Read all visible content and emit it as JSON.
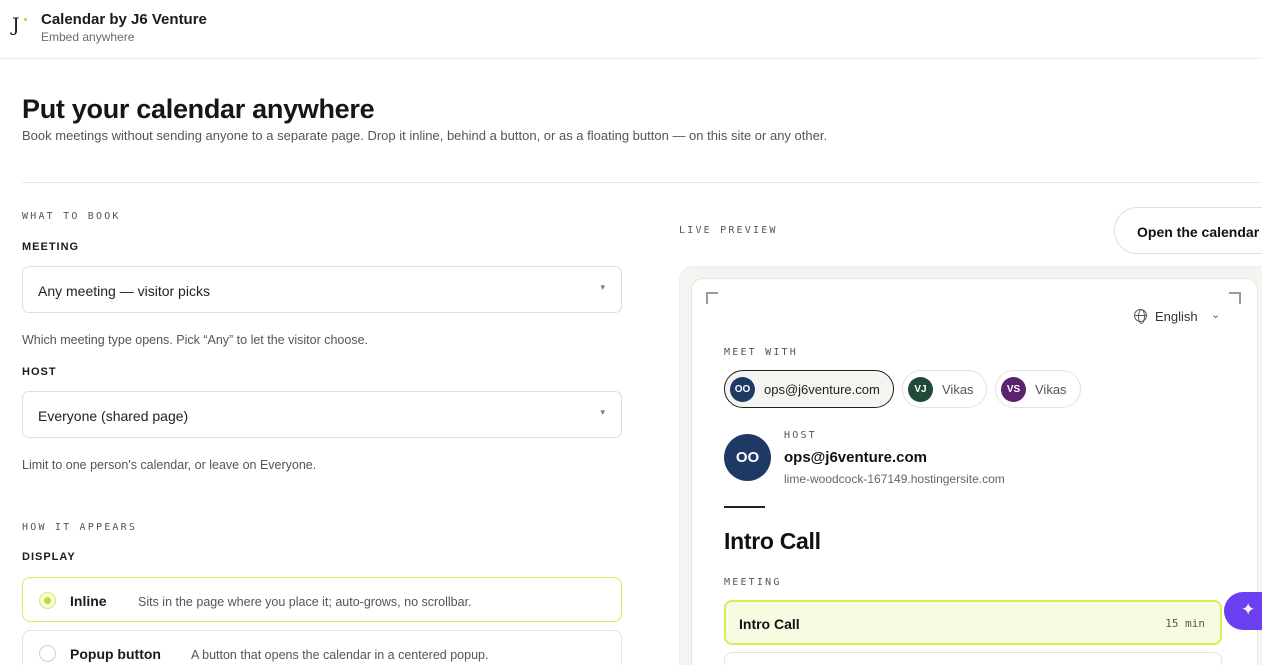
{
  "app": {
    "logo_letter": "J",
    "title": "Calendar by J6 Venture",
    "subtitle": "Embed anywhere"
  },
  "page": {
    "title": "Put your calendar anywhere",
    "description": "Book meetings without sending anyone to a separate page. Drop it inline, behind a button, or as a floating button — on this site or any other."
  },
  "config": {
    "section_what": "WHAT TO BOOK",
    "meeting_label": "MEETING",
    "meeting_value": "Any meeting — visitor picks",
    "meeting_hint": "Which meeting type opens. Pick “Any” to let the visitor choose.",
    "host_label": "HOST",
    "host_value": "Everyone (shared page)",
    "host_hint": "Limit to one person's calendar, or leave on Everyone.",
    "section_how": "HOW IT APPEARS",
    "display_label": "DISPLAY",
    "display_options": [
      {
        "title": "Inline",
        "description": "Sits in the page where you place it; auto-grows, no scrollbar.",
        "selected": true
      },
      {
        "title": "Popup button",
        "description": "A button that opens the calendar in a centered popup.",
        "selected": false
      }
    ]
  },
  "preview": {
    "label": "LIVE PREVIEW",
    "open_button": "Open the calendar",
    "language": "English",
    "meet_with_label": "MEET WITH",
    "hosts": [
      {
        "initials": "OO",
        "name": "ops@j6venture.com",
        "color": "#1e3a64",
        "active": true
      },
      {
        "initials": "VJ",
        "name": "Vikas",
        "color": "#1f4a36",
        "active": false
      },
      {
        "initials": "VS",
        "name": "Vikas",
        "color": "#5b2270",
        "active": false
      }
    ],
    "host_label": "HOST",
    "host_initials": "OO",
    "host_email": "ops@j6venture.com",
    "host_site": "lime-woodcock-167149.hostingersite.com",
    "event_title": "Intro Call",
    "meeting_label": "MEETING",
    "meeting_items": [
      {
        "name": "Intro Call",
        "duration": "15 min"
      }
    ]
  },
  "colors": {
    "accent": "#d3ef5a",
    "fab": "#6d3ff2",
    "host_avatar": "#1e3a64"
  },
  "icons": {
    "fab": "sparkle-icon",
    "language": "globe-icon"
  }
}
